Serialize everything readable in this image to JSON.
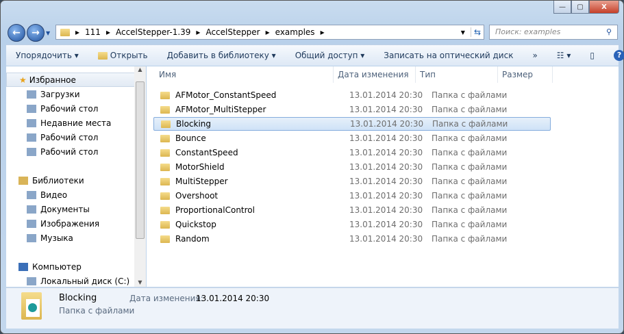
{
  "window": {
    "minimize": "—",
    "maximize": "▢",
    "close": "X"
  },
  "address": {
    "crumbs": [
      "111",
      "AccelStepper-1.39",
      "AccelStepper",
      "examples"
    ]
  },
  "search": {
    "placeholder": "Поиск: examples"
  },
  "toolbar": {
    "organize": "Упорядочить ▾",
    "open": "Открыть",
    "add_library": "Добавить в библиотеку ▾",
    "share": "Общий доступ ▾",
    "burn": "Записать на оптический диск",
    "more": "»",
    "views": "☷ ▾",
    "help": "?"
  },
  "sidebar": {
    "favorites": "Избранное",
    "fav_items": [
      "Загрузки",
      "Рабочий стол",
      "Недавние места",
      "Рабочий стол",
      "Рабочий стол"
    ],
    "libraries": "Библиотеки",
    "lib_items": [
      "Видео",
      "Документы",
      "Изображения",
      "Музыка"
    ],
    "computer": "Компьютер",
    "comp_items": [
      "Локальный диск (C:)"
    ]
  },
  "columns": [
    "Имя",
    "Дата изменения",
    "Тип",
    "Размер"
  ],
  "files": [
    {
      "name": "AFMotor_ConstantSpeed",
      "date": "13.01.2014 20:30",
      "type": "Папка с файлами"
    },
    {
      "name": "AFMotor_MultiStepper",
      "date": "13.01.2014 20:30",
      "type": "Папка с файлами"
    },
    {
      "name": "Blocking",
      "date": "13.01.2014 20:30",
      "type": "Папка с файлами"
    },
    {
      "name": "Bounce",
      "date": "13.01.2014 20:30",
      "type": "Папка с файлами"
    },
    {
      "name": "ConstantSpeed",
      "date": "13.01.2014 20:30",
      "type": "Папка с файлами"
    },
    {
      "name": "MotorShield",
      "date": "13.01.2014 20:30",
      "type": "Папка с файлами"
    },
    {
      "name": "MultiStepper",
      "date": "13.01.2014 20:30",
      "type": "Папка с файлами"
    },
    {
      "name": "Overshoot",
      "date": "13.01.2014 20:30",
      "type": "Папка с файлами"
    },
    {
      "name": "ProportionalControl",
      "date": "13.01.2014 20:30",
      "type": "Папка с файлами"
    },
    {
      "name": "Quickstop",
      "date": "13.01.2014 20:30",
      "type": "Папка с файлами"
    },
    {
      "name": "Random",
      "date": "13.01.2014 20:30",
      "type": "Папка с файлами"
    }
  ],
  "details": {
    "name": "Blocking",
    "date_label": "Дата изменения:",
    "date": "13.01.2014 20:30",
    "type": "Папка с файлами"
  }
}
